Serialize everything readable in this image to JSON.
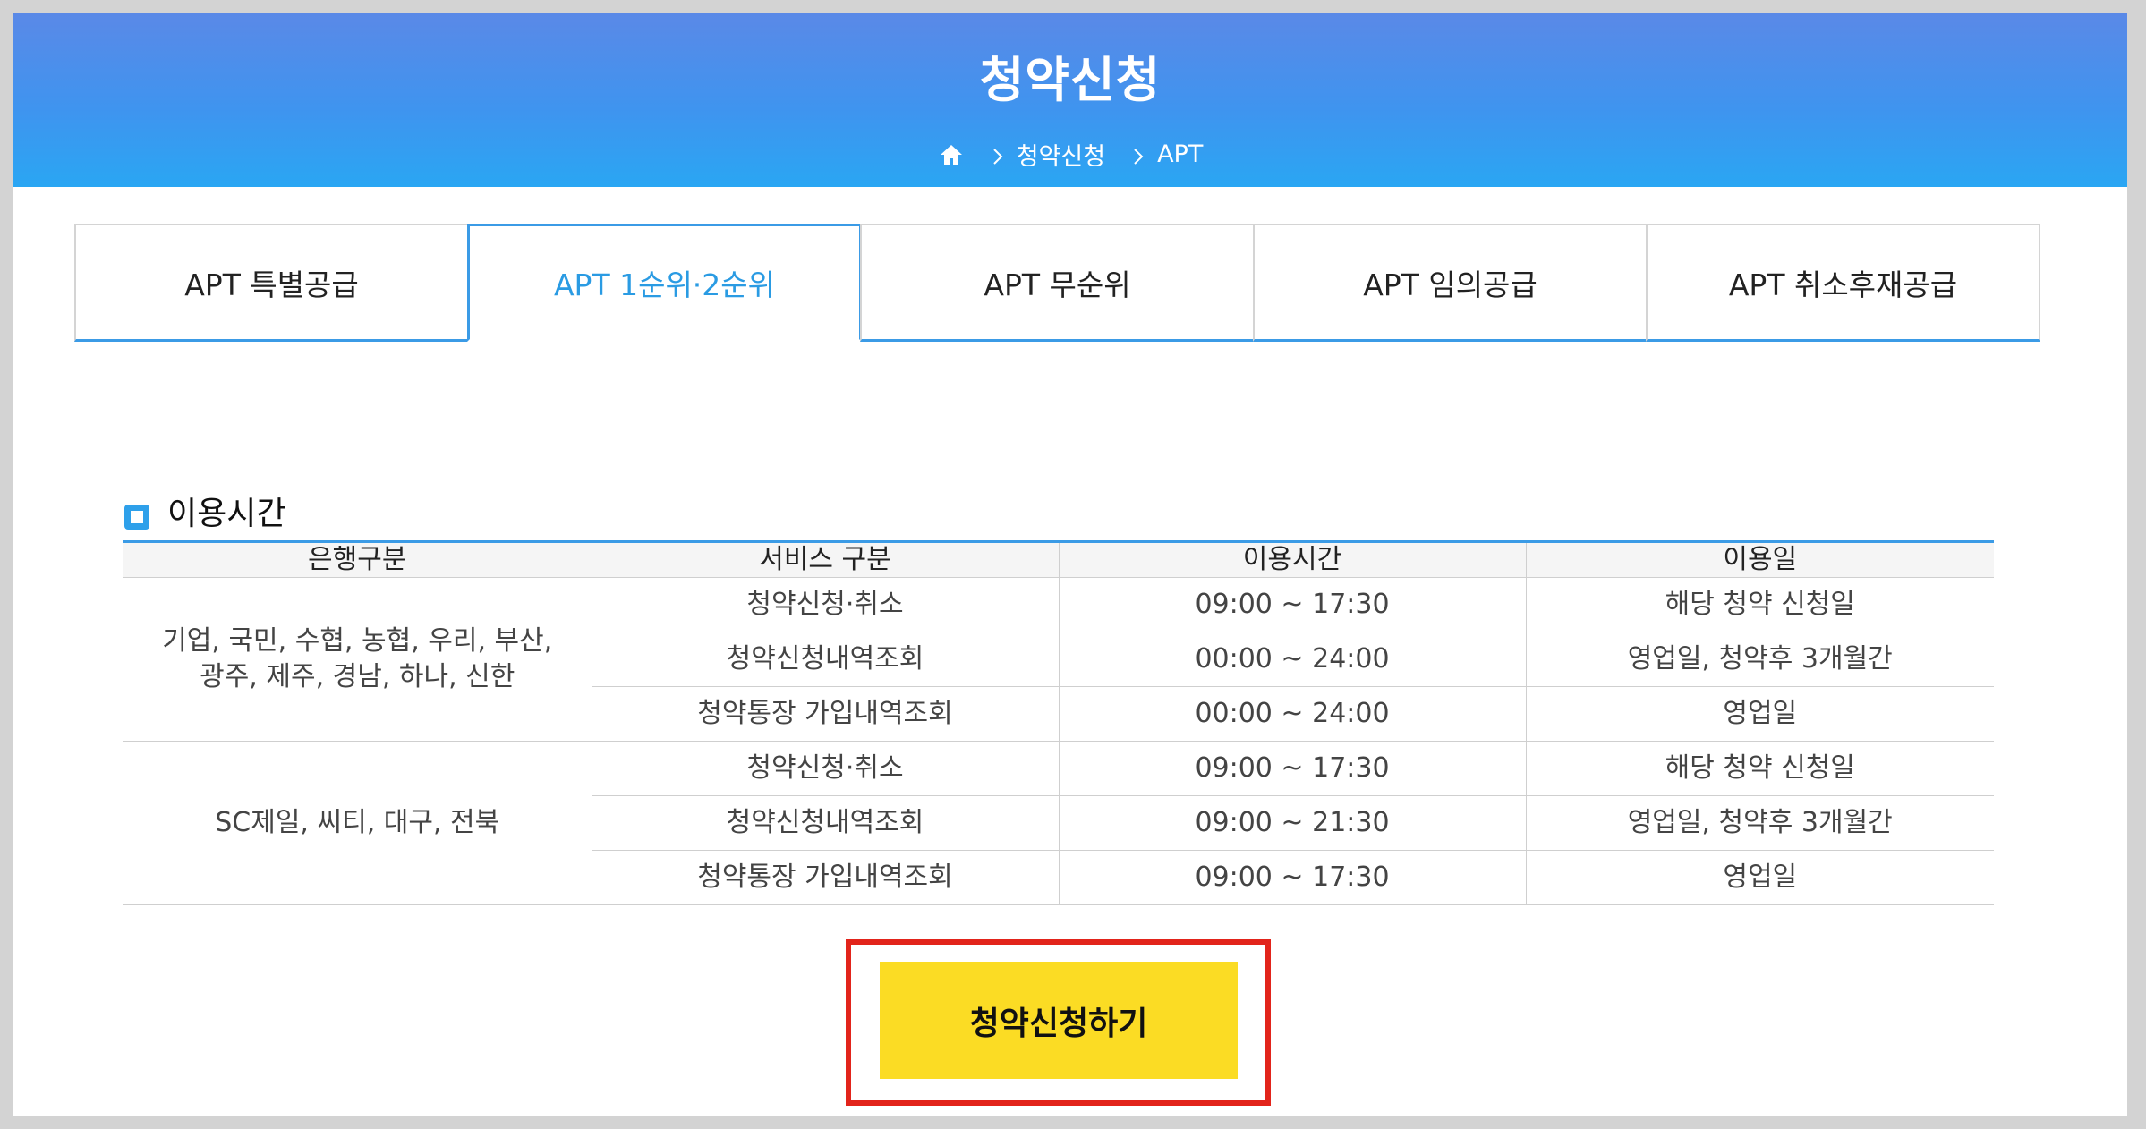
{
  "header": {
    "title": "청약신청",
    "breadcrumb": [
      "청약신청",
      "APT"
    ]
  },
  "tabs": [
    {
      "label": "APT 특별공급",
      "active": false
    },
    {
      "label": "APT 1순위·2순위",
      "active": true
    },
    {
      "label": "APT 무순위",
      "active": false
    },
    {
      "label": "APT 임의공급",
      "active": false
    },
    {
      "label": "APT 취소후재공급",
      "active": false
    }
  ],
  "section": {
    "title": "이용시간"
  },
  "table": {
    "headers": [
      "은행구분",
      "서비스 구분",
      "이용시간",
      "이용일"
    ],
    "groups": [
      {
        "bank_lines": [
          "기업, 국민, 수협, 농협, 우리, 부산,",
          "광주, 제주, 경남, 하나, 신한"
        ],
        "rows": [
          {
            "service": "청약신청·취소",
            "time": "09:00 ~ 17:30",
            "days": "해당 청약 신청일"
          },
          {
            "service": "청약신청내역조회",
            "time": "00:00 ~ 24:00",
            "days": "영업일, 청약후 3개월간"
          },
          {
            "service": "청약통장 가입내역조회",
            "time": "00:00 ~ 24:00",
            "days": "영업일"
          }
        ]
      },
      {
        "bank_lines": [
          "SC제일, 씨티, 대구, 전북"
        ],
        "rows": [
          {
            "service": "청약신청·취소",
            "time": "09:00 ~ 17:30",
            "days": "해당 청약 신청일"
          },
          {
            "service": "청약신청내역조회",
            "time": "09:00 ~ 21:30",
            "days": "영업일, 청약후 3개월간"
          },
          {
            "service": "청약통장 가입내역조회",
            "time": "09:00 ~ 17:30",
            "days": "영업일"
          }
        ]
      }
    ]
  },
  "apply_button": {
    "label": "청약신청하기"
  },
  "colors": {
    "accent": "#3b9be6",
    "button": "#fbdc24",
    "highlight_frame": "#e2241b"
  }
}
